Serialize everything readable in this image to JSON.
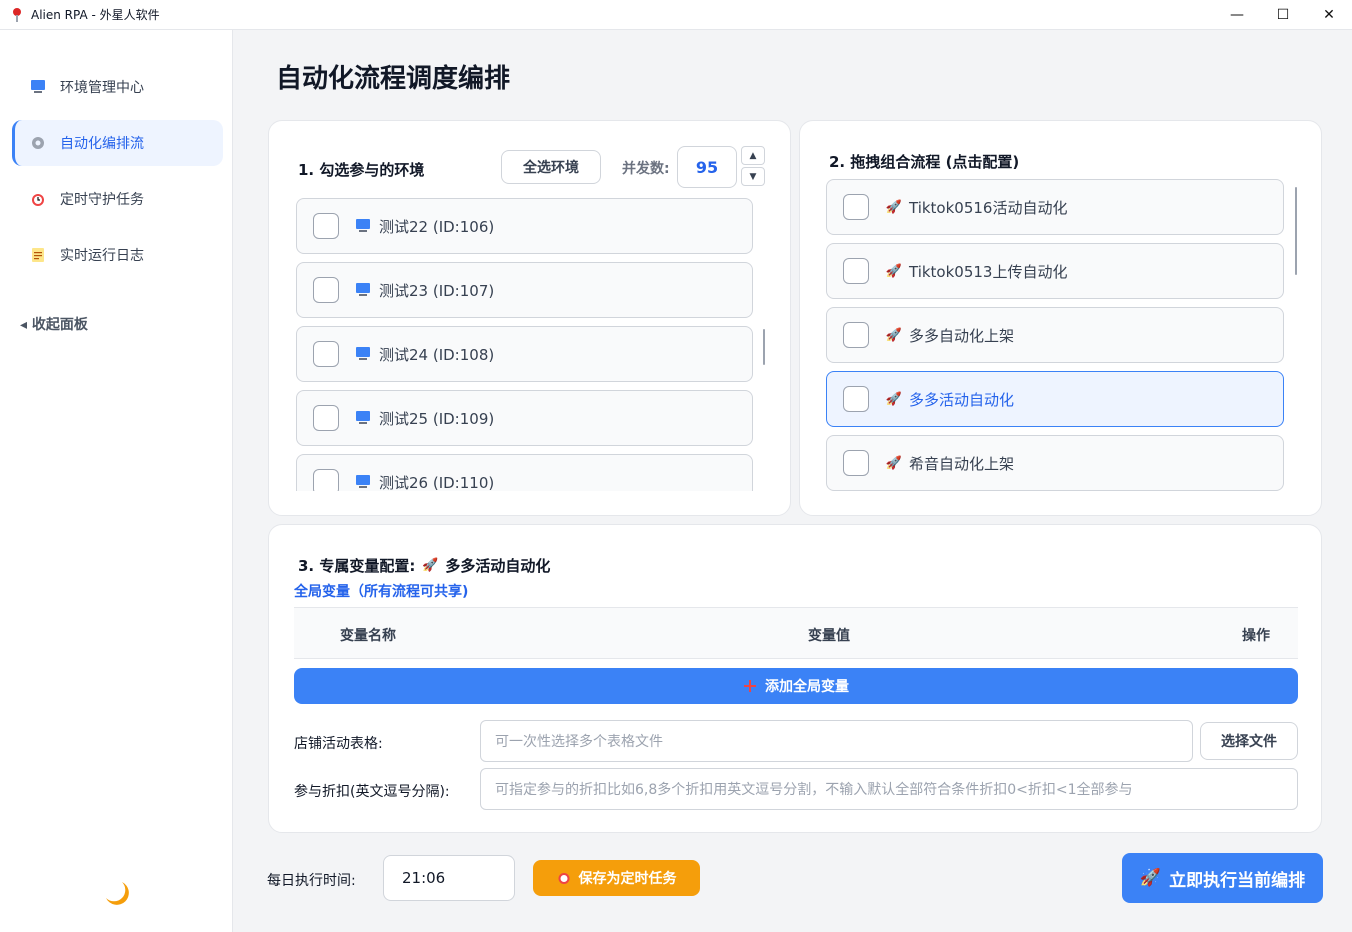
{
  "window": {
    "title": "Alien RPA - 外星人软件",
    "controls": {
      "minimize": "—",
      "maximize": "☐",
      "close": "✕"
    }
  },
  "sidebar": {
    "items": [
      {
        "label": "环境管理中心",
        "icon": "monitor-icon"
      },
      {
        "label": "自动化编排流",
        "icon": "gear-icon"
      },
      {
        "label": "定时守护任务",
        "icon": "alarm-clock-icon"
      },
      {
        "label": "实时运行日志",
        "icon": "notepad-icon"
      }
    ],
    "collapse_label": "◂ 收起面板",
    "theme_icon": "moon-icon"
  },
  "page": {
    "title": "自动化流程调度编排"
  },
  "env_panel": {
    "title": "1. 勾选参与的环境",
    "select_all_label": "全选环境",
    "concurrency_label": "并发数:",
    "concurrency_value": "95",
    "items": [
      {
        "label": "测试22 (ID:106)"
      },
      {
        "label": "测试23 (ID:107)"
      },
      {
        "label": "测试24 (ID:108)"
      },
      {
        "label": "测试25 (ID:109)"
      },
      {
        "label": "测试26 (ID:110)"
      }
    ]
  },
  "flow_panel": {
    "title": "2. 拖拽组合流程 (点击配置)",
    "items": [
      {
        "label": "Tiktok0516活动自动化",
        "selected": false
      },
      {
        "label": "Tiktok0513上传自动化",
        "selected": false
      },
      {
        "label": "多多自动化上架",
        "selected": false
      },
      {
        "label": "多多活动自动化",
        "selected": true
      },
      {
        "label": "希音自动化上架",
        "selected": false
      }
    ]
  },
  "var_panel": {
    "title_prefix": "3. 专属变量配置:",
    "title_flow": "多多活动自动化",
    "global_link": "全局变量（所有流程可共享)",
    "table_headers": {
      "name": "变量名称",
      "value": "变量值",
      "action": "操作"
    },
    "add_button": "添加全局变量",
    "fields": [
      {
        "label": "店铺活动表格:",
        "placeholder": "可一次性选择多个表格文件",
        "button": "选择文件"
      },
      {
        "label": "参与折扣(英文逗号分隔):",
        "placeholder": "可指定参与的折扣比如6,8多个折扣用英文逗号分割，不输入默认全部符合条件折扣0<折扣<1全部参与"
      }
    ]
  },
  "footer": {
    "time_label": "每日执行时间:",
    "time_value": "21:06",
    "save_button": "保存为定时任务",
    "run_button": "立即执行当前编排"
  },
  "colors": {
    "accent": "#3b82f6",
    "orange": "#f59e0b",
    "selected_bg": "#eef4ff"
  }
}
